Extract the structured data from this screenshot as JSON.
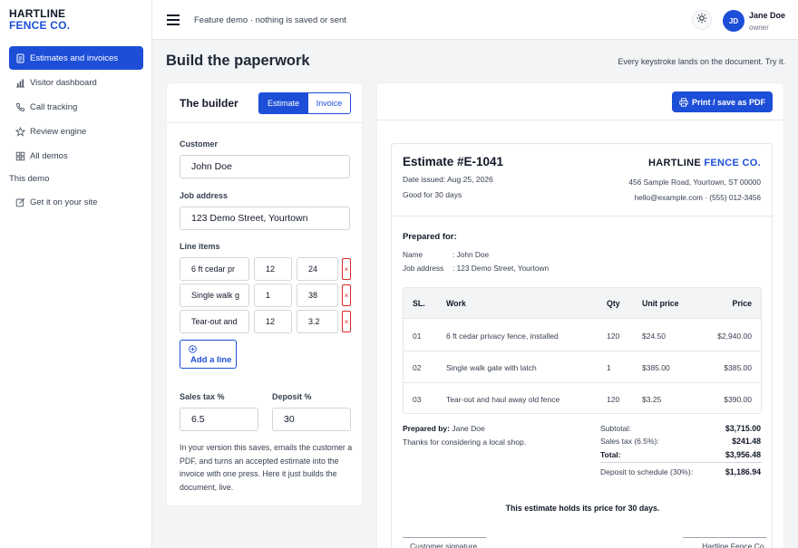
{
  "brand": {
    "line1": "HARTLINE",
    "line2": "FENCE CO."
  },
  "sidebar": {
    "items": [
      {
        "label": "Estimates and invoices",
        "icon": "document-icon",
        "active": true
      },
      {
        "label": "Visitor dashboard",
        "icon": "bar-chart-icon"
      },
      {
        "label": "Call tracking",
        "icon": "phone-icon"
      },
      {
        "label": "Review engine",
        "icon": "star-icon"
      },
      {
        "label": "All demos",
        "icon": "grid-icon"
      }
    ],
    "section_label": "This demo",
    "section_items": [
      {
        "label": "Get it on your site",
        "icon": "edit-icon"
      }
    ]
  },
  "header": {
    "demo_note": "Feature demo · nothing is saved or sent",
    "user": {
      "initials": "JD",
      "name": "Jane Doe",
      "role": "owner"
    }
  },
  "page": {
    "title": "Build the paperwork",
    "hint": "Every keystroke lands on the document. Try it."
  },
  "builder": {
    "title": "The builder",
    "tabs": [
      "Estimate",
      "Invoice"
    ],
    "active_tab": "Estimate",
    "customer_label": "Customer",
    "customer_value": "John Doe",
    "address_label": "Job address",
    "address_value": "123 Demo Street, Yourtown",
    "line_items_label": "Line items",
    "line_items": [
      {
        "desc": "6 ft cedar pr",
        "qty": "12",
        "price": "24"
      },
      {
        "desc": "Single walk g",
        "qty": "1",
        "price": "38"
      },
      {
        "desc": "Tear-out and",
        "qty": "12",
        "price": "3.2"
      }
    ],
    "remove_label": "×",
    "add_line_label": "Add a line",
    "tax_label": "Sales tax %",
    "tax_value": "6.5",
    "deposit_label": "Deposit %",
    "deposit_value": "30",
    "note": "In your version this saves, emails the customer a PDF, and turns an accepted estimate into the invoice with one press. Here it just builds the document, live."
  },
  "print_button": "Print / save as PDF",
  "document": {
    "number": "Estimate #E-1041",
    "date_issued": "Date issued: Aug 25, 2026",
    "validity": "Good for 30 days",
    "brand_part1": "HARTLINE",
    "brand_part2": "FENCE CO.",
    "address": "456 Sample Road, Yourtown, ST 00000",
    "contact": "hello@example.com · (555) 012-3456",
    "prepared_for_title": "Prepared for:",
    "name_key": "Name",
    "name_value": ": John Doe",
    "job_key": "Job address",
    "job_value": ": 123 Demo Street, Yourtown",
    "table_headers": {
      "sl": "SL.",
      "work": "Work",
      "qty": "Qty",
      "unit": "Unit price",
      "price": "Price"
    },
    "rows": [
      {
        "sl": "01",
        "work": "6 ft cedar privacy fence, installed",
        "qty": "120",
        "unit": "$24.50",
        "price": "$2,940.00"
      },
      {
        "sl": "02",
        "work": "Single walk gate with latch",
        "qty": "1",
        "unit": "$385.00",
        "price": "$385.00"
      },
      {
        "sl": "03",
        "work": "Tear-out and haul away old fence",
        "qty": "120",
        "unit": "$3.25",
        "price": "$390.00"
      }
    ],
    "prepared_by_label": "Prepared by:",
    "prepared_by_name": "Jane Doe",
    "thanks": "Thanks for considering a local shop.",
    "subtotal_label": "Subtotal:",
    "subtotal_value": "$3,715.00",
    "tax_label": "Sales tax (6.5%):",
    "tax_value": "$241.48",
    "total_label": "Total:",
    "total_value": "$3,956.48",
    "deposit_label": "Deposit to schedule (30%):",
    "deposit_value": "$1,186.94",
    "holds_note": "This estimate holds its price for 30 days.",
    "signature_left": "Customer signature",
    "signature_right": "Hartline Fence Co."
  }
}
